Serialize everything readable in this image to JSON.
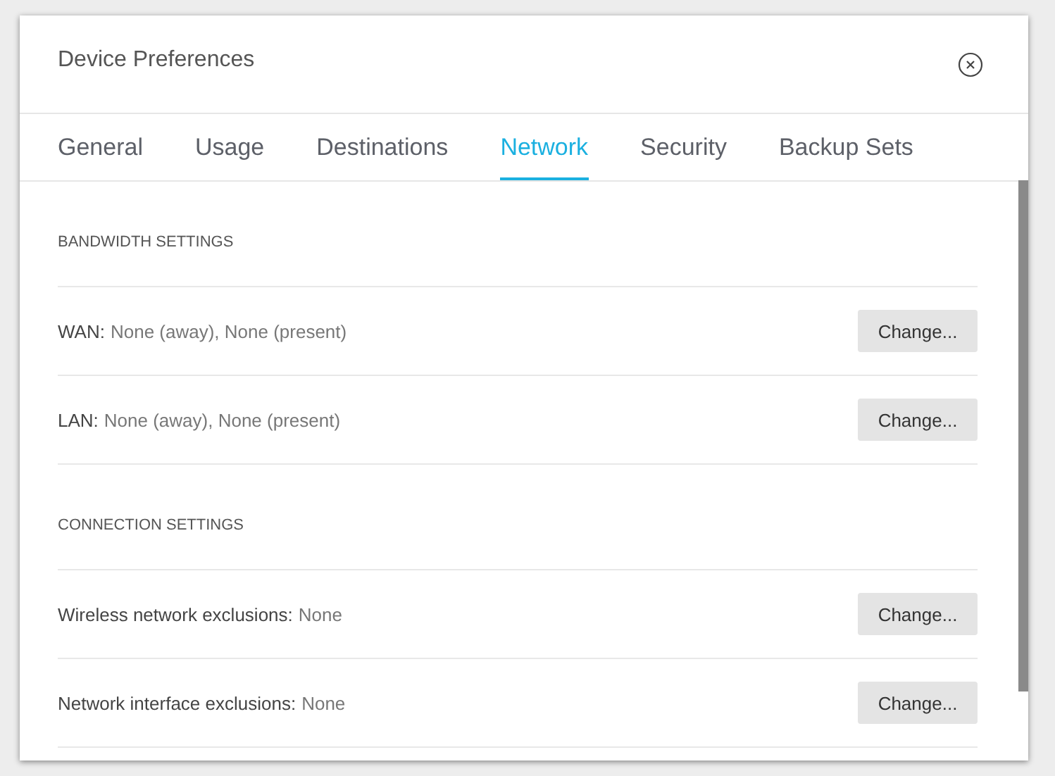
{
  "dialog": {
    "title": "Device Preferences"
  },
  "tabs": [
    {
      "label": "General",
      "selected": false
    },
    {
      "label": "Usage",
      "selected": false
    },
    {
      "label": "Destinations",
      "selected": false
    },
    {
      "label": "Network",
      "selected": true
    },
    {
      "label": "Security",
      "selected": false
    },
    {
      "label": "Backup Sets",
      "selected": false
    }
  ],
  "sections": [
    {
      "heading": "BANDWIDTH SETTINGS",
      "rows": [
        {
          "label": "WAN:",
          "value": "None (away), None (present)",
          "button": "Change..."
        },
        {
          "label": "LAN:",
          "value": "None (away), None (present)",
          "button": "Change..."
        }
      ]
    },
    {
      "heading": "CONNECTION SETTINGS",
      "rows": [
        {
          "label": "Wireless network exclusions:",
          "value": "None",
          "button": "Change..."
        },
        {
          "label": "Network interface exclusions:",
          "value": "None",
          "button": "Change..."
        }
      ]
    }
  ]
}
